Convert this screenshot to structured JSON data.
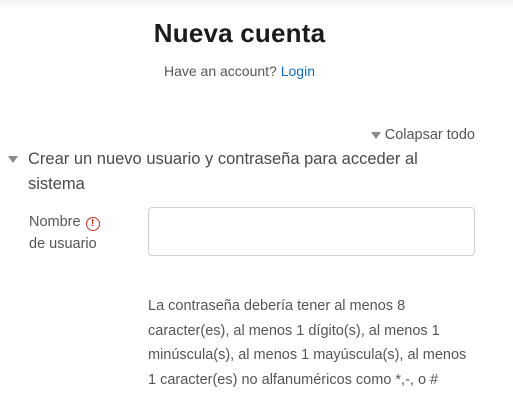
{
  "page": {
    "title": "Nueva cuenta",
    "have_account_text": "Have an account?",
    "login_link": "Login"
  },
  "form": {
    "collapse_all_label": "Colapsar todo",
    "section_title": "Crear un nuevo usuario y contraseña para acceder al sistema",
    "username_label_line1": "Nombre",
    "username_label_line2": "de usuario",
    "required_icon_glyph": "!",
    "username_value": "",
    "password_hint": "La contraseña debería tener al menos 8 caracter(es), al menos 1 dígito(s), al menos 1 minúscula(s), al menos 1 mayúscula(s), al menos 1 caracter(es) no alfanuméricos como *,-, o #"
  },
  "colors": {
    "link": "#0f6cbf",
    "required": "#ca3120"
  },
  "icons": {
    "collapse_all": "triangle-down-icon",
    "section_toggle": "triangle-down-icon",
    "required": "exclamation-circle-icon"
  }
}
